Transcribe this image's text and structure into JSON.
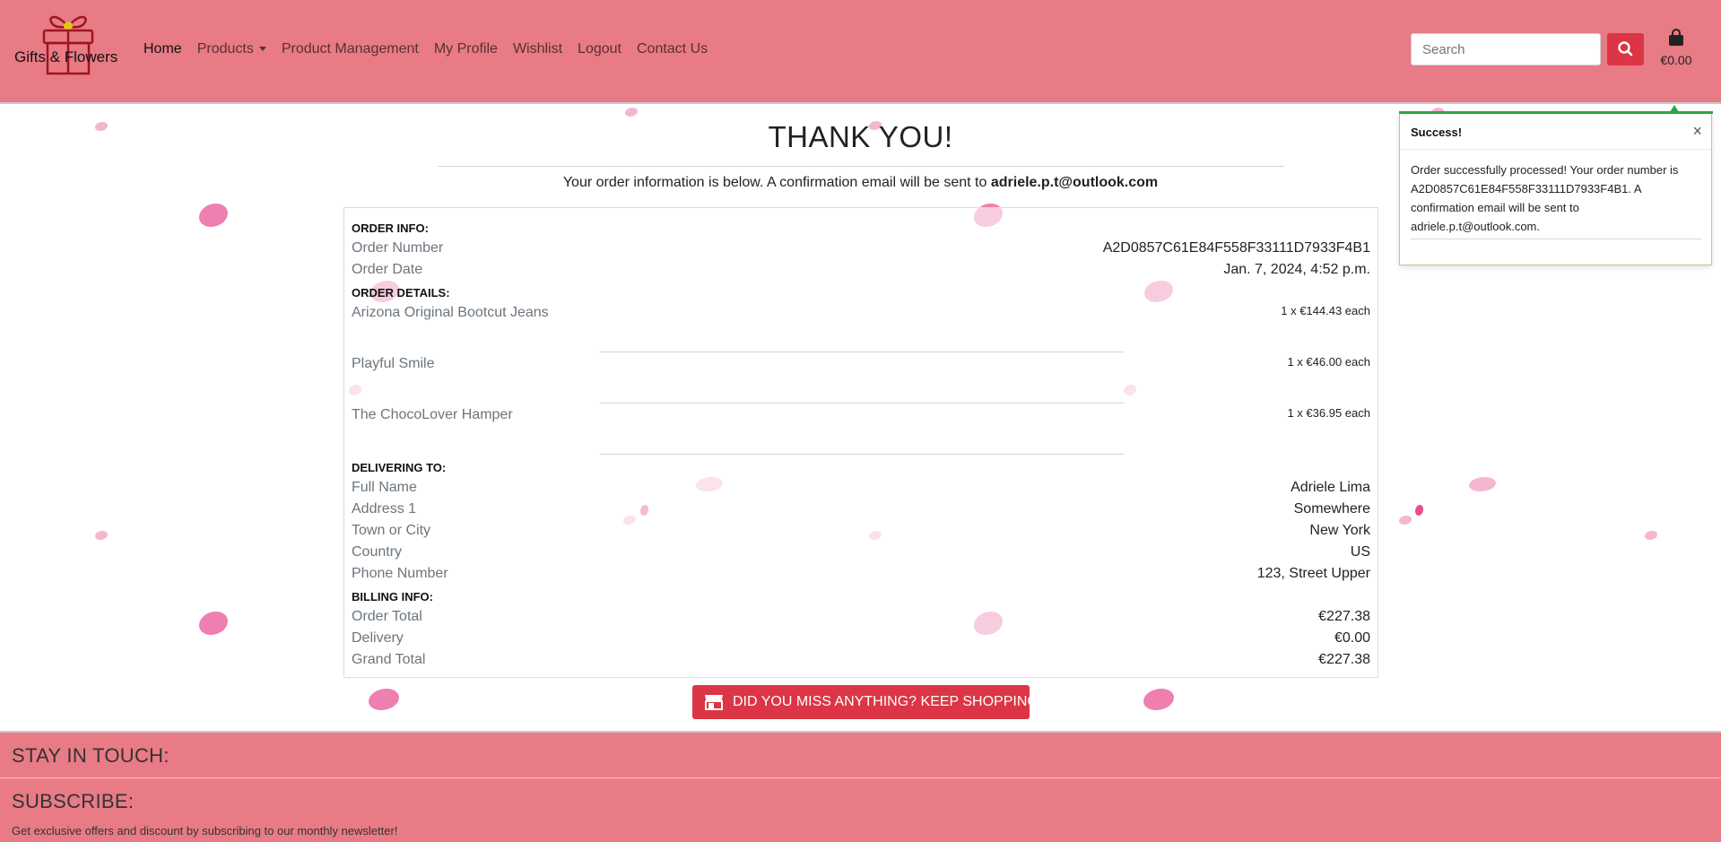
{
  "header": {
    "brand": "Gifts & Flowers",
    "nav": {
      "home": "Home",
      "products": "Products",
      "product_management": "Product Management",
      "my_profile": "My Profile",
      "wishlist": "Wishlist",
      "logout": "Logout",
      "contact_us": "Contact Us"
    },
    "search_placeholder": "Search",
    "bag_total": "€0.00"
  },
  "main": {
    "title": "THANK YOU!",
    "lead_text": "Your order information is below. A confirmation email will be sent to",
    "lead_email": "adriele.p.t@outlook.com",
    "order_info": {
      "heading": "ORDER INFO:",
      "order_number_label": "Order Number",
      "order_number": "A2D0857C61E84F558F33111D7933F4B1",
      "order_date_label": "Order Date",
      "order_date": "Jan. 7, 2024, 4:52 p.m."
    },
    "order_details": {
      "heading": "ORDER DETAILS:",
      "items": [
        {
          "name": "Arizona Original Bootcut Jeans",
          "qty_price": "1 x €144.43 each"
        },
        {
          "name": "Playful Smile",
          "qty_price": "1 x €46.00 each"
        },
        {
          "name": "The ChocoLover Hamper",
          "qty_price": "1 x €36.95 each"
        }
      ]
    },
    "delivering_to": {
      "heading": "DELIVERING TO:",
      "full_name_label": "Full Name",
      "full_name": "Adriele Lima",
      "address1_label": "Address 1",
      "address1": "Somewhere",
      "town_label": "Town or City",
      "town": "New York",
      "country_label": "Country",
      "country": "US",
      "phone_label": "Phone Number",
      "phone": "123, Street Upper"
    },
    "billing": {
      "heading": "BILLING INFO:",
      "order_total_label": "Order Total",
      "order_total": "€227.38",
      "delivery_label": "Delivery",
      "delivery": "€0.00",
      "grand_total_label": "Grand Total",
      "grand_total": "€227.38"
    },
    "keep_shopping": "DID YOU MISS ANYTHING? KEEP SHOPPING!"
  },
  "toast": {
    "title": "Success!",
    "close": "×",
    "body": "Order successfully processed! Your order number is A2D0857C61E84F558F33111D7933F4B1. A confirmation email will be sent to adriele.p.t@outlook.com.",
    "accent_color": "#28a745"
  },
  "footer": {
    "stay_in_touch": "STAY IN TOUCH:",
    "subscribe": "SUBSCRIBE:",
    "subscribe_text": "Get exclusive offers and discount by subscribing to our monthly newsletter!"
  },
  "colors": {
    "brand_pink": "#e87b85",
    "danger": "#dc3545",
    "petal": "#f08cb4"
  },
  "icons": {
    "logo": "gift-box-icon",
    "search": "search-icon",
    "bag": "shopping-bag-icon",
    "store": "store-icon"
  }
}
